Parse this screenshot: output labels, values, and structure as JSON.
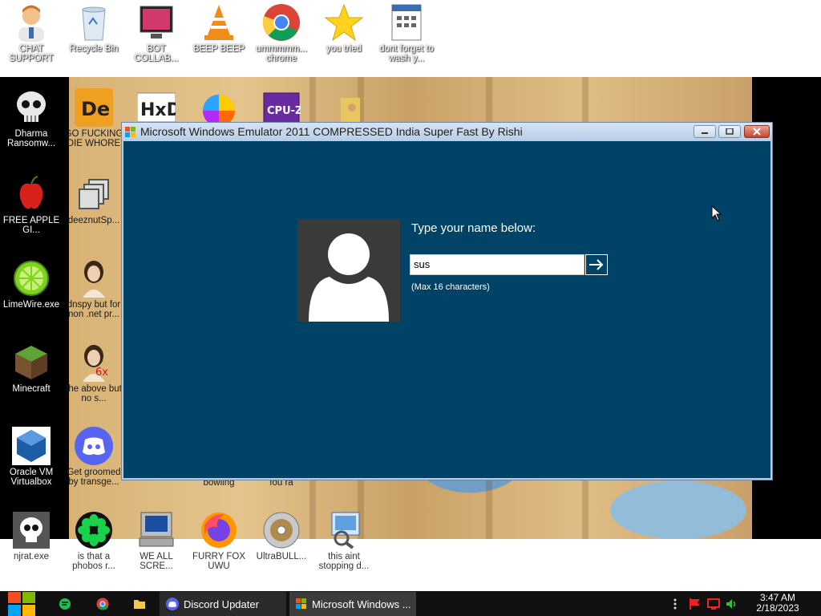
{
  "desktop": {
    "icons": [
      {
        "label": "CHAT SUPPORT",
        "icon": "support-person-icon"
      },
      {
        "label": "Recycle Bin",
        "icon": "recycle-bin-icon"
      },
      {
        "label": "BOT COLLAB...",
        "icon": "monitor-icon"
      },
      {
        "label": "BEEP BEEP",
        "icon": "vlc-cone-icon"
      },
      {
        "label": "ummmmm... chrome",
        "icon": "chrome-icon"
      },
      {
        "label": "you tried",
        "icon": "star-icon"
      },
      {
        "label": "dont forget to wash y...",
        "icon": "document-icon"
      },
      {
        "label": "Dharma Ransomw...",
        "icon": "skull-icon"
      },
      {
        "label": "GO FUCKING DIE WHORE",
        "icon": "de-app-icon"
      },
      {
        "label": "HxD",
        "icon": "hxd-icon"
      },
      {
        "label": "",
        "icon": "color-wheel-icon"
      },
      {
        "label": "CPU-Z",
        "icon": "cpuz-icon"
      },
      {
        "label": "",
        "icon": "folder-user-icon"
      },
      {
        "label": "FREE APPLE GI...",
        "icon": "apple-icon"
      },
      {
        "label": "deeznutSp...",
        "icon": "windows-stack-icon"
      },
      {
        "label": "LimeWire.exe",
        "icon": "limewire-icon"
      },
      {
        "label": "dnspy but for non .net pr...",
        "icon": "portrait-icon"
      },
      {
        "label": "Minecraft",
        "icon": "grass-block-icon"
      },
      {
        "label": "the above but no s...",
        "icon": "portrait-icon"
      },
      {
        "label": "Oracle VM Virtualbox",
        "icon": "virtualbox-icon"
      },
      {
        "label": "Get groomed by transge...",
        "icon": "discord-icon"
      },
      {
        "label": "bowling",
        "icon": "partial-icon"
      },
      {
        "label": "fou ra",
        "icon": "partial-icon"
      },
      {
        "label": "njrat.exe",
        "icon": "skull-icon"
      },
      {
        "label": "is that a phobos r...",
        "icon": "icq-flower-icon"
      },
      {
        "label": "WE ALL SCRE...",
        "icon": "old-computer-icon"
      },
      {
        "label": "FURRY FOX UWU",
        "icon": "firefox-icon"
      },
      {
        "label": "UltraBULL...",
        "icon": "disc-icon"
      },
      {
        "label": "this aint stopping d...",
        "icon": "network-computer-icon"
      }
    ]
  },
  "window": {
    "title": "Microsoft Windows Emulator 2011 COMPRESSED India Super Fast By Rishi",
    "prompt": "Type your name below:",
    "name_value": "sus",
    "max_note": "(Max 16 characters)"
  },
  "taskbar": {
    "apps": [
      {
        "label": "Discord Updater",
        "icon": "discord-icon"
      },
      {
        "label": "Microsoft Windows ...",
        "icon": "app-window-icon"
      }
    ],
    "time": "3:47 AM",
    "date": "2/18/2023"
  },
  "colors": {
    "client_bg": "#004367",
    "taskbar_bg": "#101010"
  }
}
